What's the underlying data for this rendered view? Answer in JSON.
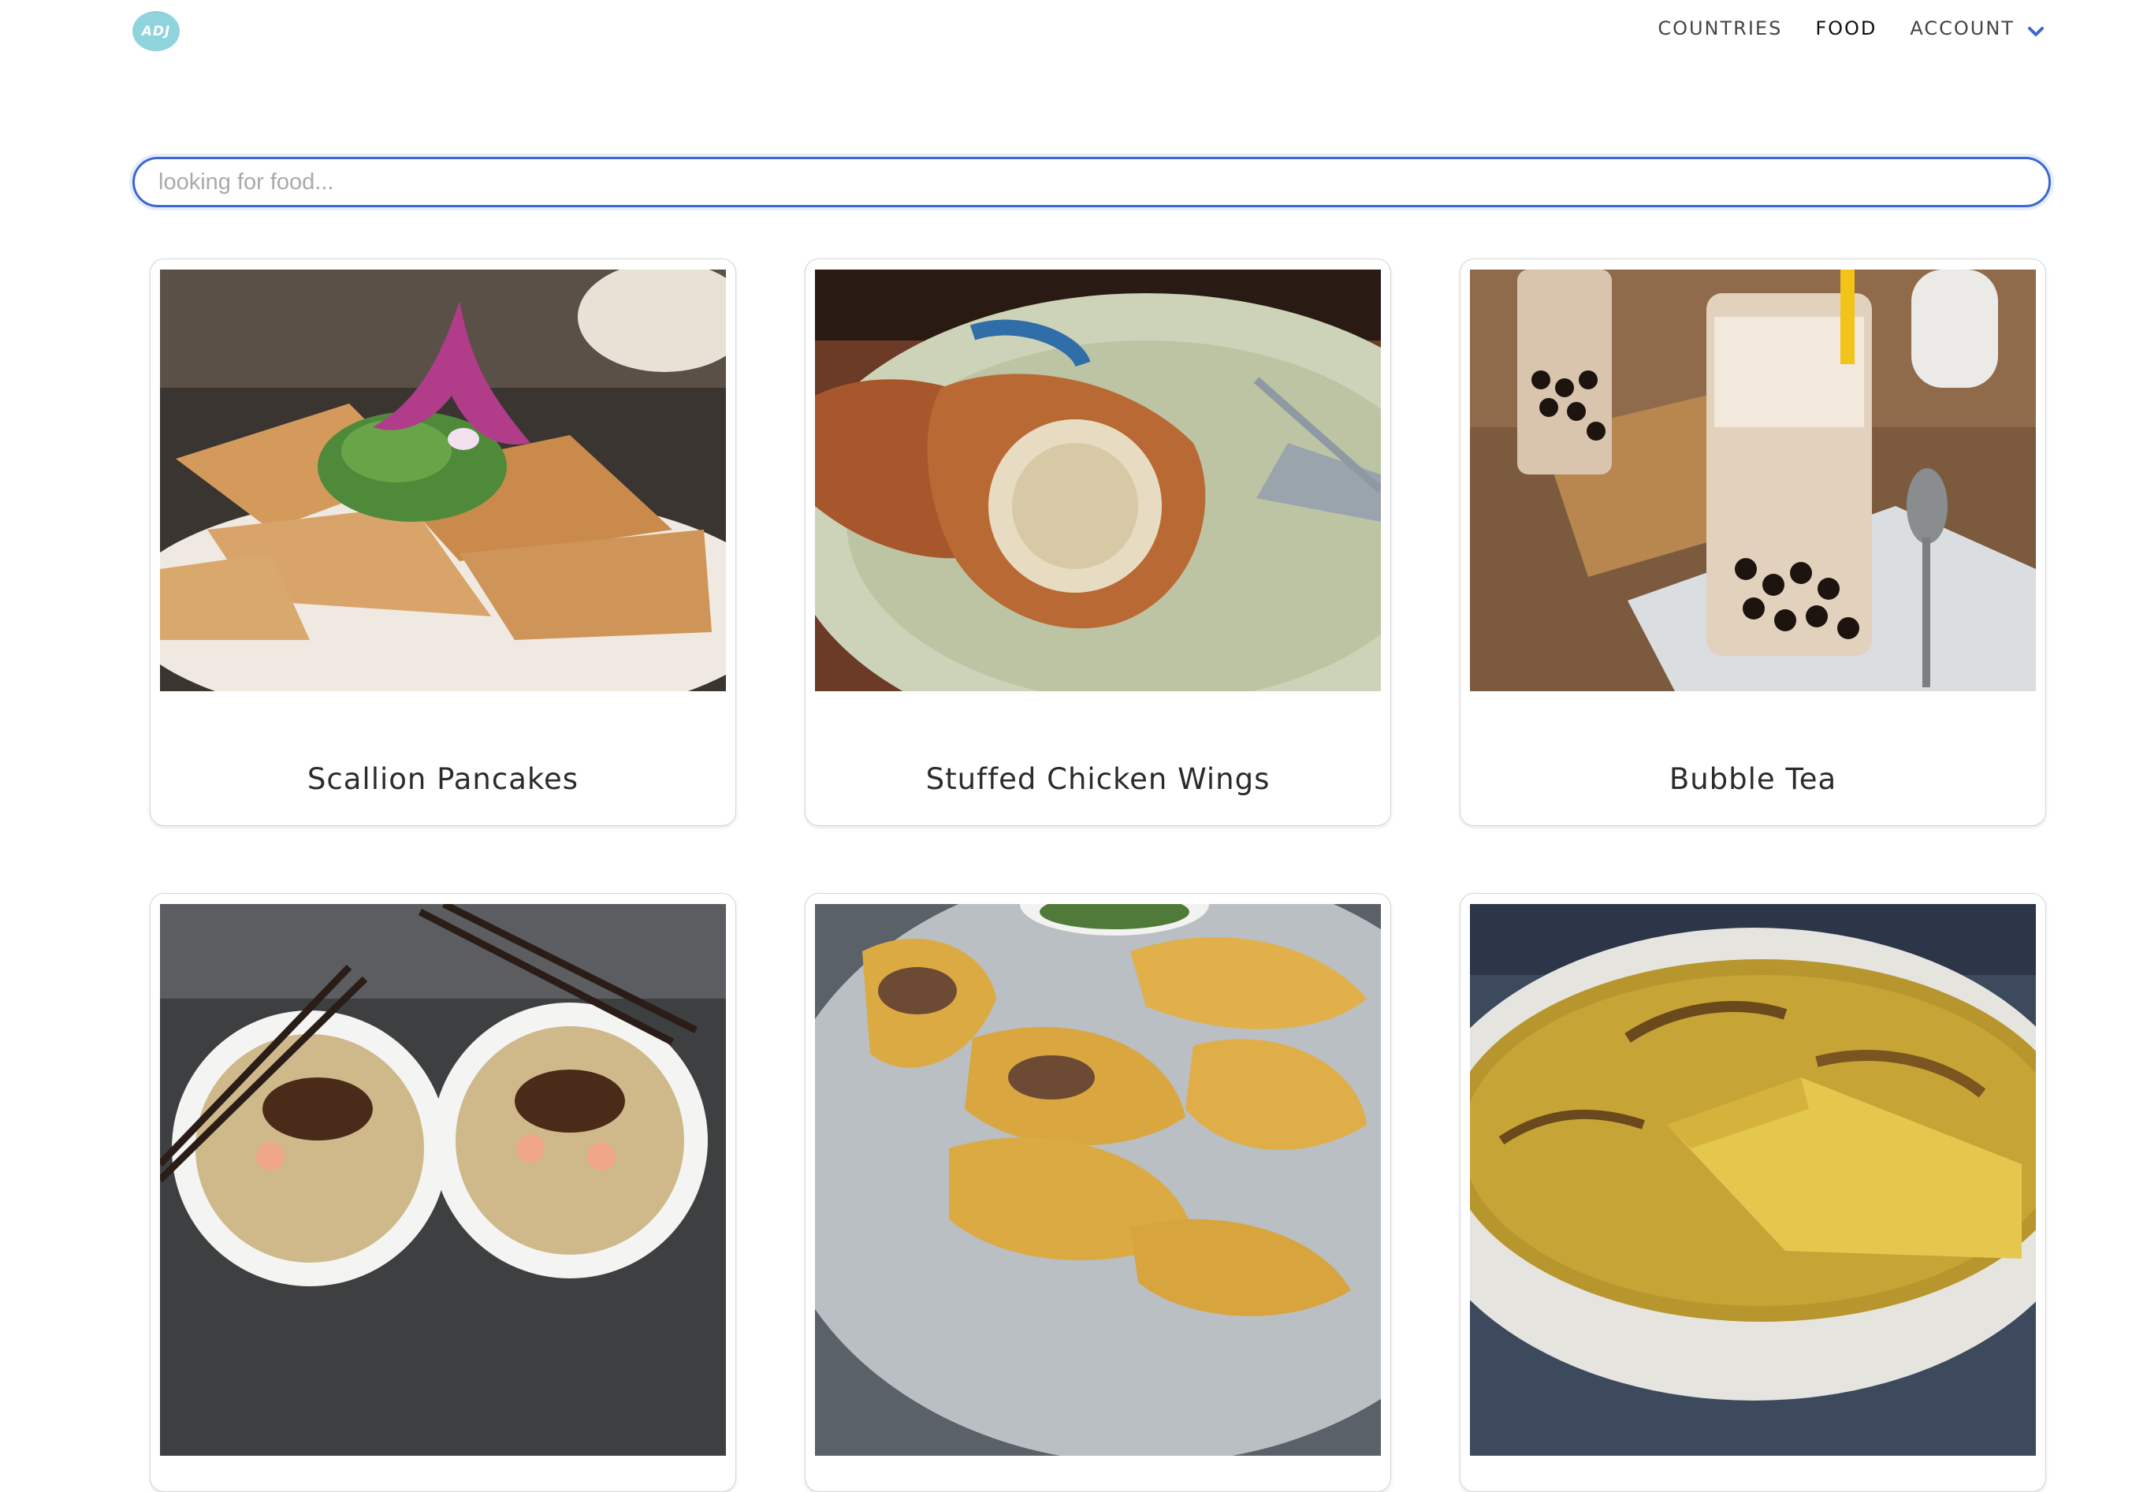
{
  "header": {
    "logo_text": "ADJ",
    "nav": {
      "countries": "COUNTRIES",
      "food": "FOOD",
      "account": "ACCOUNT"
    },
    "active": "food",
    "icons": {
      "account_dropdown": "chevron-down-icon"
    },
    "colors": {
      "logo_bg": "#8fd4dc",
      "chevron": "#3c67d4"
    }
  },
  "search": {
    "value": "",
    "placeholder": "looking for food..."
  },
  "foods": [
    {
      "name": "Scallion Pancakes"
    },
    {
      "name": "Stuffed Chicken Wings"
    },
    {
      "name": "Bubble Tea"
    },
    {
      "name": ""
    },
    {
      "name": ""
    },
    {
      "name": ""
    }
  ]
}
